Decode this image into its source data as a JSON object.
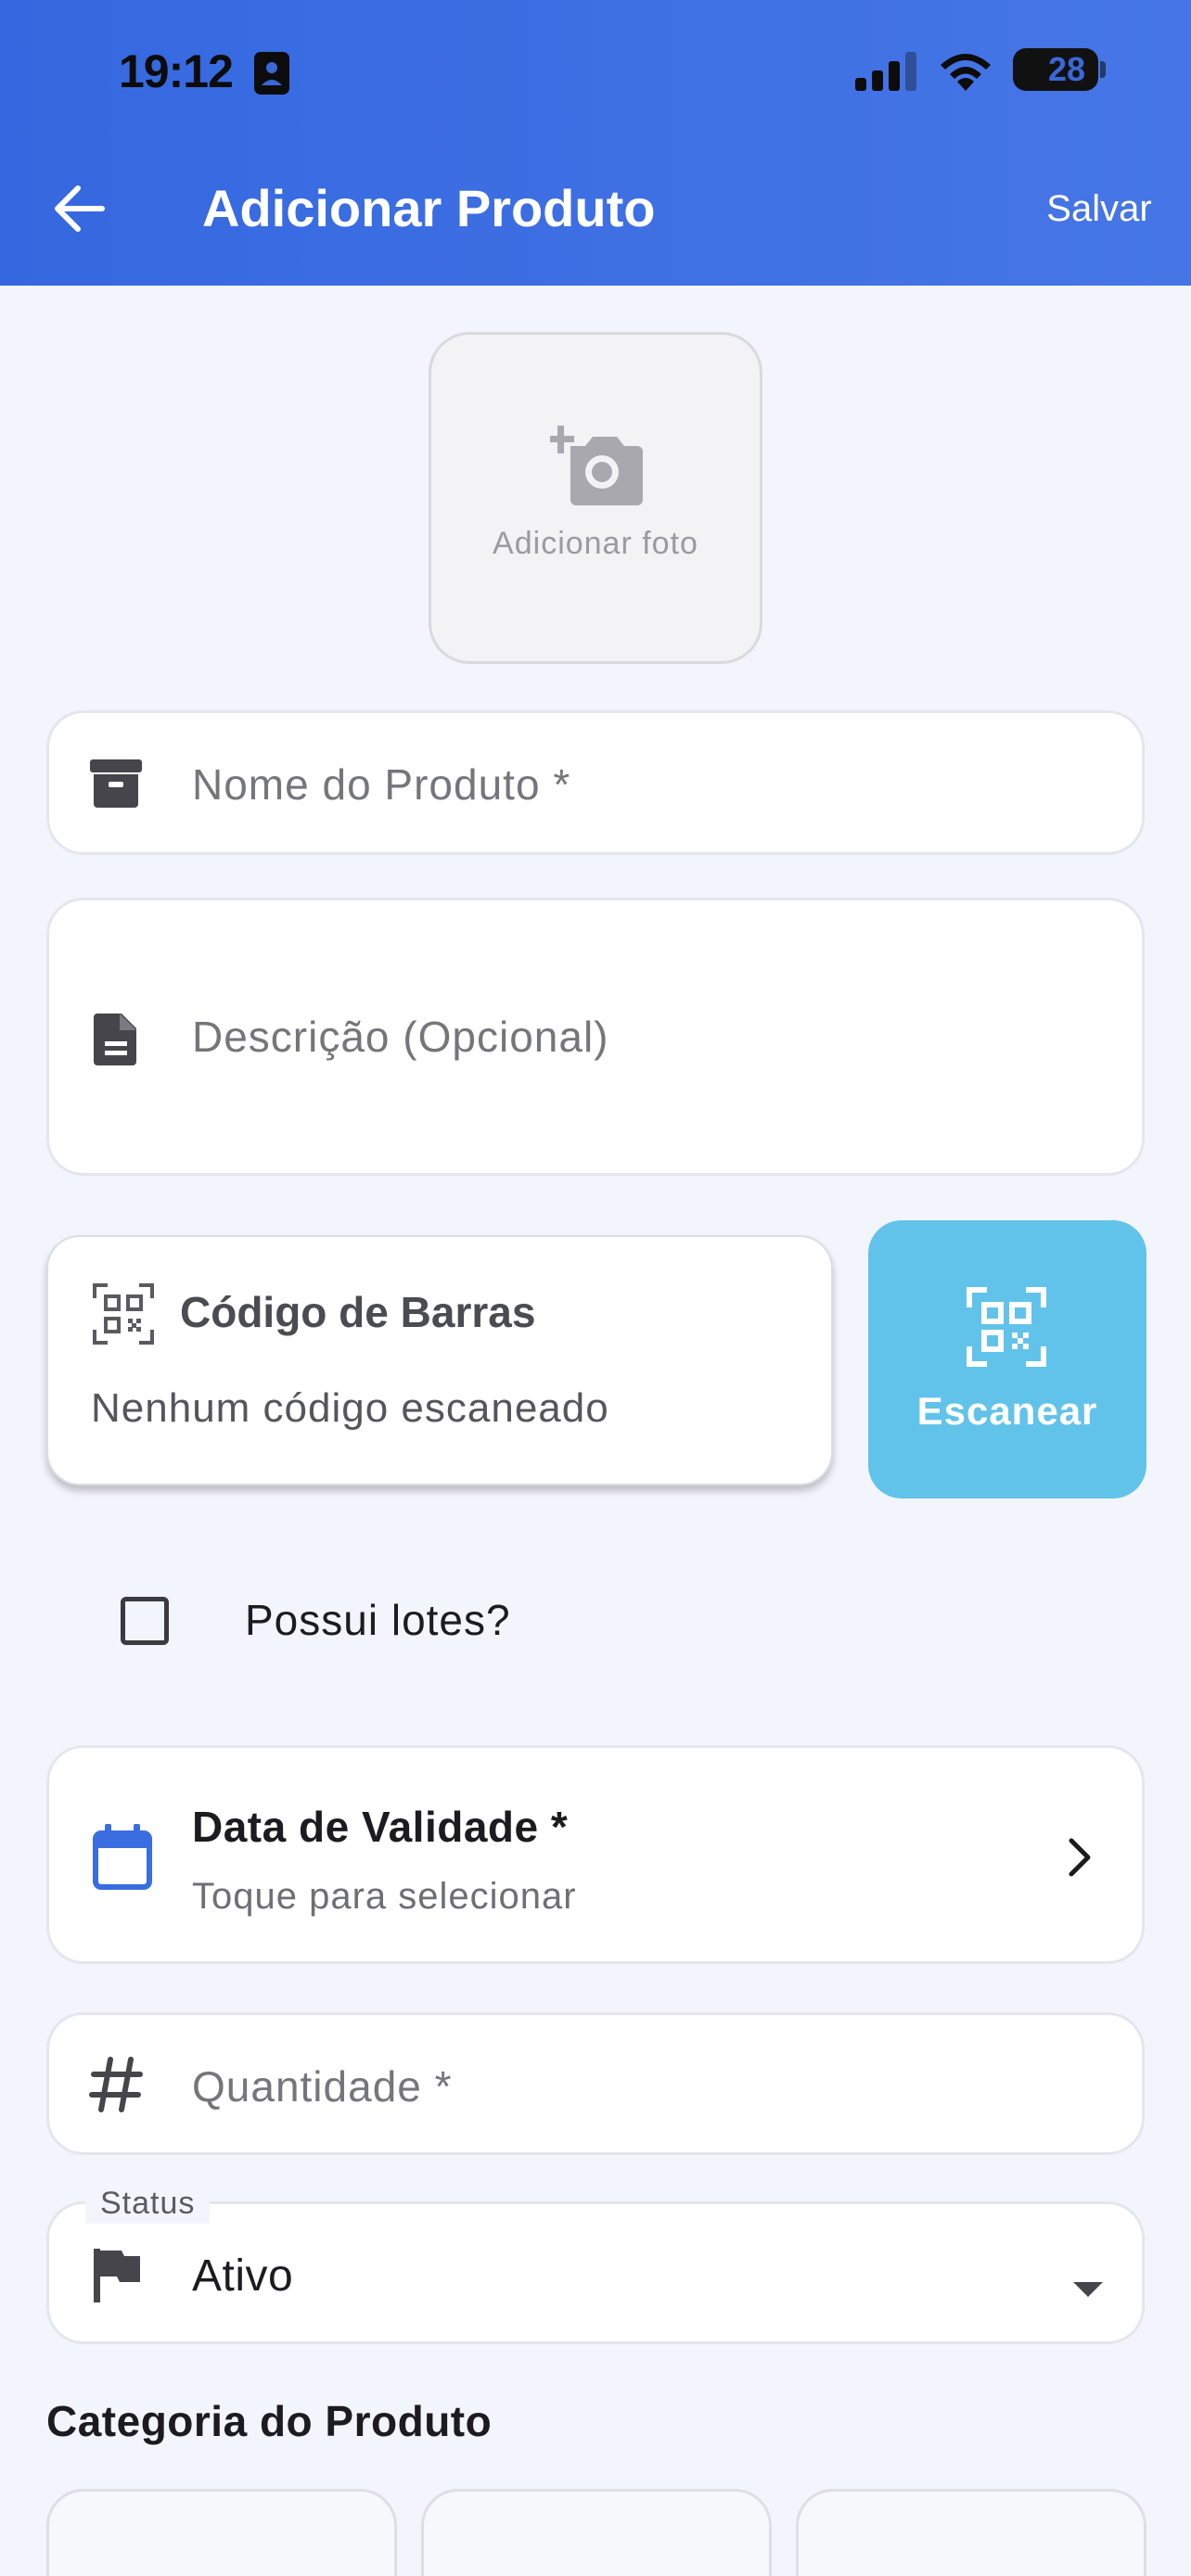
{
  "status_bar": {
    "time": "19:12",
    "battery": "28"
  },
  "header": {
    "title": "Adicionar Produto",
    "save_label": "Salvar"
  },
  "photo": {
    "label": "Adicionar foto"
  },
  "fields": {
    "name_placeholder": "Nome do Produto *",
    "description_placeholder": "Descrição (Opcional)",
    "quantity_placeholder": "Quantidade *"
  },
  "barcode": {
    "title": "Código de Barras",
    "status": "Nenhum código escaneado",
    "scan_label": "Escanear"
  },
  "lots": {
    "label": "Possui lotes?",
    "checked": false
  },
  "expiry": {
    "title": "Data de Validade *",
    "subtitle": "Toque para selecionar"
  },
  "status_field": {
    "legend": "Status",
    "value": "Ativo"
  },
  "category": {
    "title": "Categoria do Produto"
  },
  "colors": {
    "header_start": "#3568E0",
    "header_end": "#4676E6",
    "scan_button": "#62C3EA",
    "calendar_icon": "#3A6EE0",
    "background": "#F2F5FC"
  }
}
